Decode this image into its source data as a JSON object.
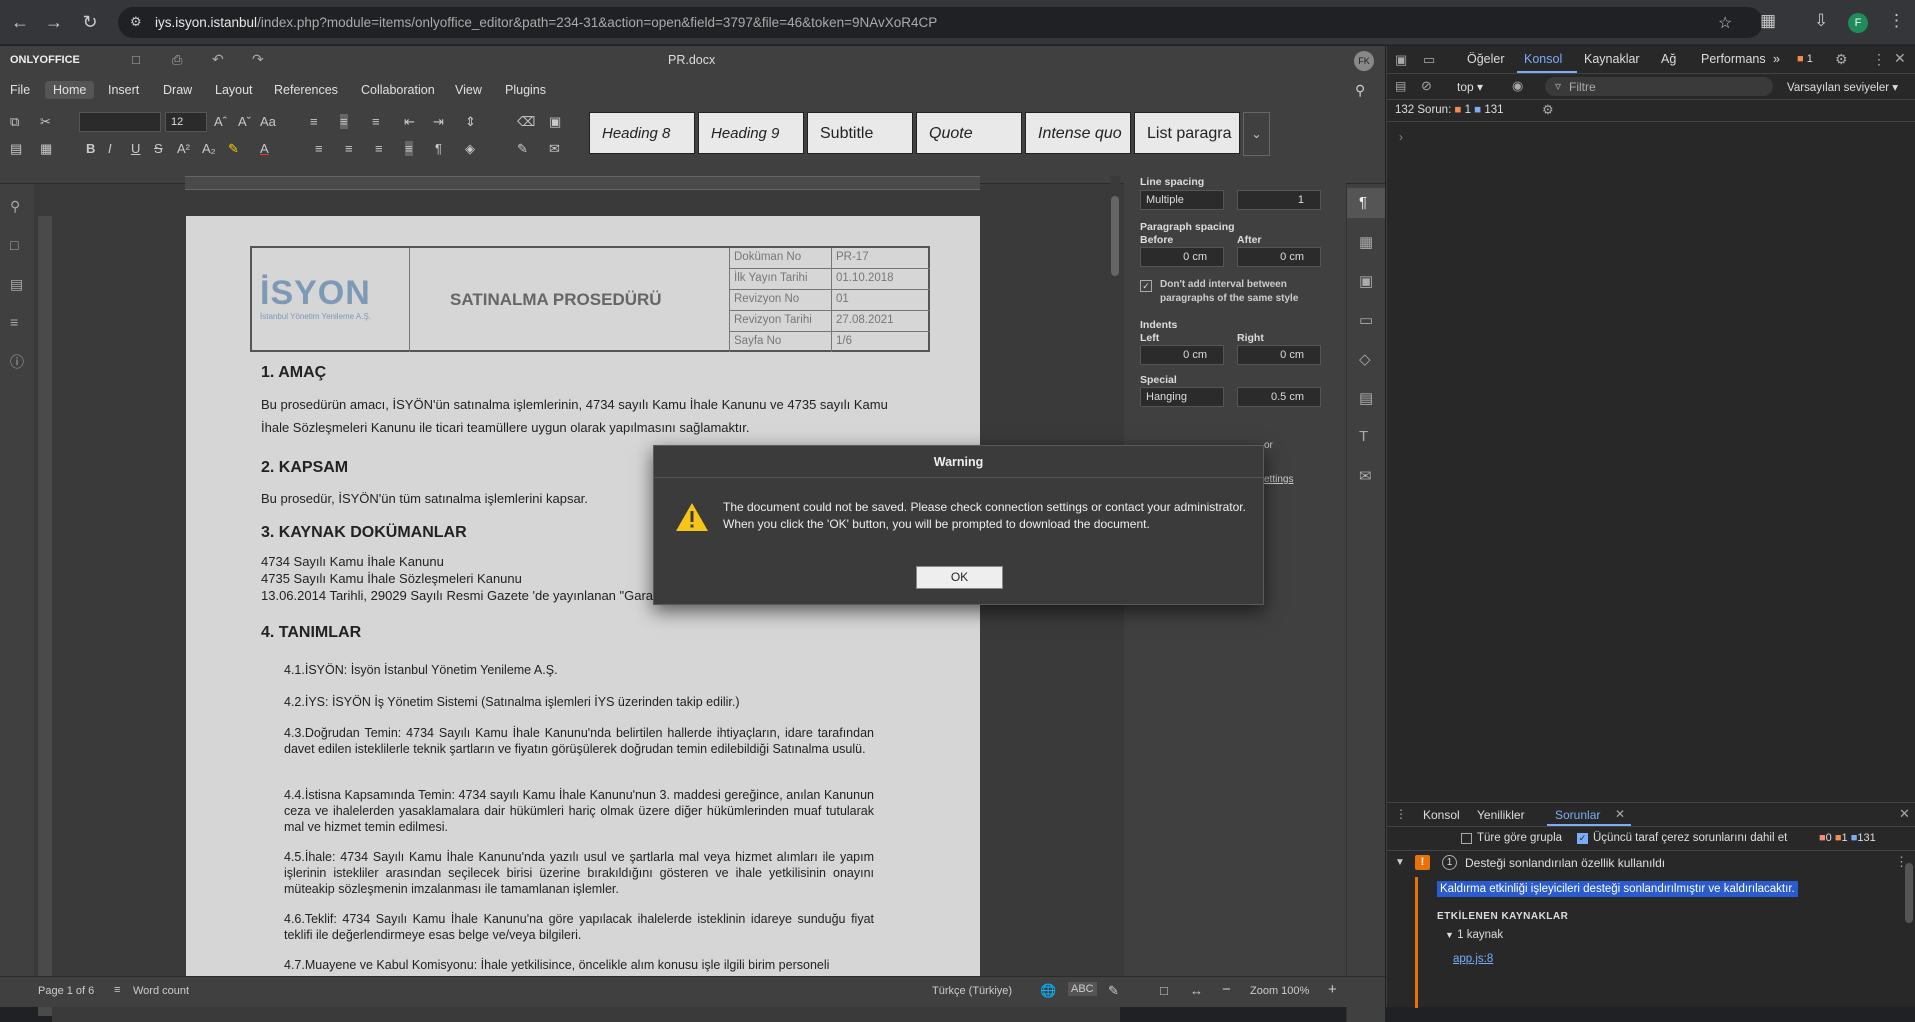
{
  "browser": {
    "url_host": "iys.isyon.istanbul",
    "url_path": "/index.php?module=items/onlyoffice_editor&path=234-31&action=open&field=3797&file=46&token=9NAvXoR4CP",
    "avatar": "F"
  },
  "editor": {
    "brand": "ONLYOFFICE",
    "doc_title": "PR.docx",
    "user_initials": "FK",
    "tabs": [
      "File",
      "Home",
      "Insert",
      "Draw",
      "Layout",
      "References",
      "Collaboration",
      "View",
      "Plugins"
    ],
    "font_size": "12",
    "styles": [
      "Heading 8",
      "Heading 9",
      "Subtitle",
      "Quote",
      "Intense quo",
      "List paragra"
    ]
  },
  "right_panel": {
    "line_spacing_label": "Line spacing",
    "line_spacing_mode": "Multiple",
    "line_spacing_value": "1",
    "paragraph_spacing_label": "Paragraph spacing",
    "before_label": "Before",
    "after_label": "After",
    "before_value": "0 cm",
    "after_value": "0 cm",
    "dont_add_interval": "Don't add interval between paragraphs of the same style",
    "indents_label": "Indents",
    "left_label": "Left",
    "right_label": "Right",
    "left_value": "0 cm",
    "right_value": "0 cm",
    "special_label": "Special",
    "special_mode": "Hanging",
    "special_value": "0.5 cm",
    "partial_1": "or",
    "partial_2": "ettings"
  },
  "document": {
    "logo_text": "İSYON",
    "logo_sub": "İstanbul Yönetim Yenileme A.Ş.",
    "procedure_title": "SATINALMA PROSEDÜRÜ",
    "meta_labels": [
      "Doküman No",
      "İlk Yayın Tarihi",
      "Revizyon No",
      "Revizyon Tarihi",
      "Sayfa No"
    ],
    "meta_values": [
      "PR-17",
      "01.10.2018",
      "01",
      "27.08.2021",
      "1/6"
    ],
    "h_amac": "1. AMAÇ",
    "amac_text_1": "Bu prosedürün amacı, İSYÖN'ün satınalma işlemlerinin, 4734 sayılı Kamu İhale Kanunu ve 4735 sayılı Kamu",
    "amac_text_2": "İhale Sözleşmeleri Kanunu ile ticari teamüllere uygun olarak yapılmasını sağlamaktır.",
    "h_kapsam": "2.  KAPSAM",
    "kapsam_text": "Bu prosedür, İSYÖN'ün tüm satınalma işlemlerini kapsar.",
    "h_kaynak": "3.  KAYNAK DOKÜMANLAR",
    "kaynak_1": "4734 Sayılı Kamu İhale Kanunu",
    "kaynak_2": "4735 Sayılı Kamu İhale Sözleşmeleri Kanunu",
    "kaynak_3": "13.06.2014 Tarihli, 29029 Sayılı Resmi Gazete 'de yayınlanan \"Garanti Belgesi Yönetmeliği\"",
    "h_tanimlar": "4. TANIMLAR",
    "items": [
      "4.1.İSYÖN: İsyön İstanbul Yönetim Yenileme A.Ş.",
      "4.2.İYS: İSYÖN İş Yönetim Sistemi (Satınalma işlemleri İYS üzerinden takip edilir.)",
      "4.3.Doğrudan Temin: 4734 Sayılı Kamu İhale Kanunu'nda belirtilen hallerde ihtiyaçların, idare tarafından davet edilen isteklilerle teknik şartların ve fiyatın görüşülerek doğrudan temin edilebildiği Satınalma usulü.",
      "4.4.İstisna Kapsamında Temin: 4734 sayılı Kamu İhale Kanunu'nun 3. maddesi gereğince, anılan Kanunun ceza ve ihalelerden yasaklamalara dair hükümleri hariç olmak üzere diğer hükümlerinden muaf tutularak mal ve hizmet temin edilmesi.",
      "4.5.İhale: 4734 Sayılı Kamu İhale Kanunu'nda yazılı usul ve şartlarla mal veya hizmet alımları ile yapım işlerinin istekliler arasından seçilecek birisi üzerine bırakıldığını gösteren ve ihale yetkilisinin onayını müteakip sözleşmenin imzalanması ile tamamlanan işlemler.",
      "4.6.Teklif: 4734 Sayılı Kamu İhale Kanunu'na göre yapılacak ihalelerde isteklinin idareye sunduğu fiyat teklifi ile değerlendirmeye esas belge ve/veya bilgileri.",
      "4.7.Muayene ve Kabul Komisyonu: İhale yetkilisince, öncelikle alım konusu işle ilgili birim personeli"
    ]
  },
  "dialog": {
    "title": "Warning",
    "message_1": "The document could not be saved. Please check connection settings or contact your administrator.",
    "message_2": "When you click the 'OK' button, you will be prompted to download the document.",
    "ok": "OK"
  },
  "status": {
    "page": "Page 1 of 6",
    "word_count": "Word count",
    "language": "Türkçe (Türkiye)",
    "zoom": "Zoom 100%"
  },
  "devtools": {
    "tabs": [
      "Öğeler",
      "Konsol",
      "Kaynaklar",
      "Ağ",
      "Performans"
    ],
    "issue_badge": "1",
    "context": "top",
    "filter_placeholder": "Filtre",
    "levels": "Varsayılan seviyeler",
    "issues_summary": "132 Sorun:",
    "issues_warn": "1",
    "issues_info": "131",
    "bottom_tabs": [
      "Konsol",
      "Yenilikler",
      "Sorunlar"
    ],
    "group_by_type": "Türe göre grupla",
    "third_party": "Üçüncü taraf çerez sorunlarını dahil et",
    "count_err": "0",
    "count_warn": "1",
    "count_info": "131",
    "issue_count": "1",
    "issue_title": "Desteği sonlandırılan özellik kullanıldı",
    "issue_detail": "Kaldırma etkinliği işleyicileri desteği sonlandırılmıştır ve kaldırılacaktır.",
    "affected": "ETKİLENEN KAYNAKLAR",
    "sources": "1 kaynak",
    "source_file": "app.js:8"
  }
}
